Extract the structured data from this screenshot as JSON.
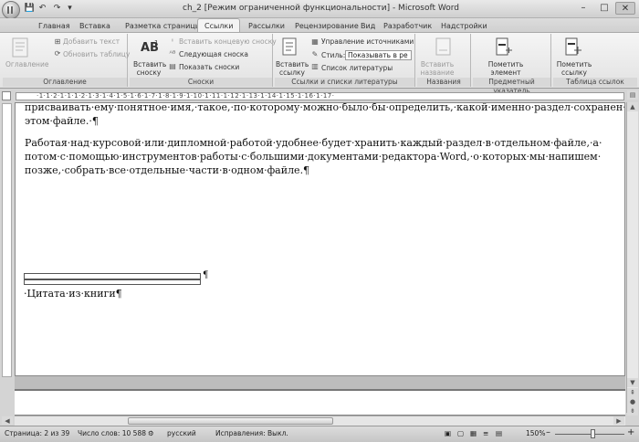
{
  "window": {
    "title": "ch_2 [Режим ограниченной функциональности] - Microsoft Word",
    "minimize": "–",
    "maximize": "□",
    "close": "✕"
  },
  "qat": {
    "save": "💾",
    "undo": "↶",
    "redo": "↷",
    "more": "▾"
  },
  "tabs": [
    {
      "label": "Главная"
    },
    {
      "label": "Вставка"
    },
    {
      "label": "Разметка страницы"
    },
    {
      "label": "Ссылки"
    },
    {
      "label": "Рассылки"
    },
    {
      "label": "Рецензирование"
    },
    {
      "label": "Вид"
    },
    {
      "label": "Разработчик"
    },
    {
      "label": "Надстройки"
    }
  ],
  "ribbon": {
    "toc": {
      "button": "Оглавление",
      "add_text": "Добавить текст",
      "update_table": "Обновить таблицу",
      "label": "Оглавление"
    },
    "footnotes": {
      "insert": "Вставить сноску",
      "insert_endnote": "Вставить концевую сноску",
      "next": "Следующая сноска",
      "show": "Показать сноски",
      "label": "Сноски"
    },
    "citations": {
      "insert": "Вставить ссылку",
      "manage": "Управление источниками",
      "style_label": "Стиль:",
      "style_value": "Показывать в ре",
      "bibliography": "Список литературы",
      "label": "Ссылки и списки литературы"
    },
    "captions": {
      "insert": "Вставить название",
      "label": "Названия"
    },
    "index": {
      "mark": "Пометить элемент",
      "label": "Предметный указатель"
    },
    "toa": {
      "mark": "Пометить ссылку",
      "label": "Таблица ссылок"
    }
  },
  "ruler": {
    "numbers": "·1·1·2·1·1·1·2·1·3·1·4·1·5·1·6·1·7·1·8·1·9·1·10·1·11·1·12·1·13·1·14·1·15·1·16·1·17·"
  },
  "document": {
    "p1_line1": "присваивать·ему·понятное·имя,·такое,·по·которому·можно·было·бы·определить,·какой·именно·раздел·сохранен·в·",
    "p1_line2": "этом·файле.·¶",
    "p2_line1": "Работая·над·курсовой·или·дипломной·работой·удобнее·будет·хранить·каждый·раздел·в·отдельном·файле,·а·",
    "p2_line2": "потом·с·помощью·инструментов·работы·с·большими·документами·редактора·Word,·о·которых·мы·напишем·",
    "p2_line3": "позже,·собрать·все·отдельные·части·в·одном·файле.¶",
    "table_mark": "¶",
    "caption": "·Цитата·из·книги¶"
  },
  "status": {
    "page": "Страница: 2 из 39",
    "words": "Число слов: 10 588",
    "language": "русский",
    "track": "Исправления: Выкл.",
    "zoom": "150%",
    "zoom_minus": "–",
    "zoom_plus": "+"
  }
}
